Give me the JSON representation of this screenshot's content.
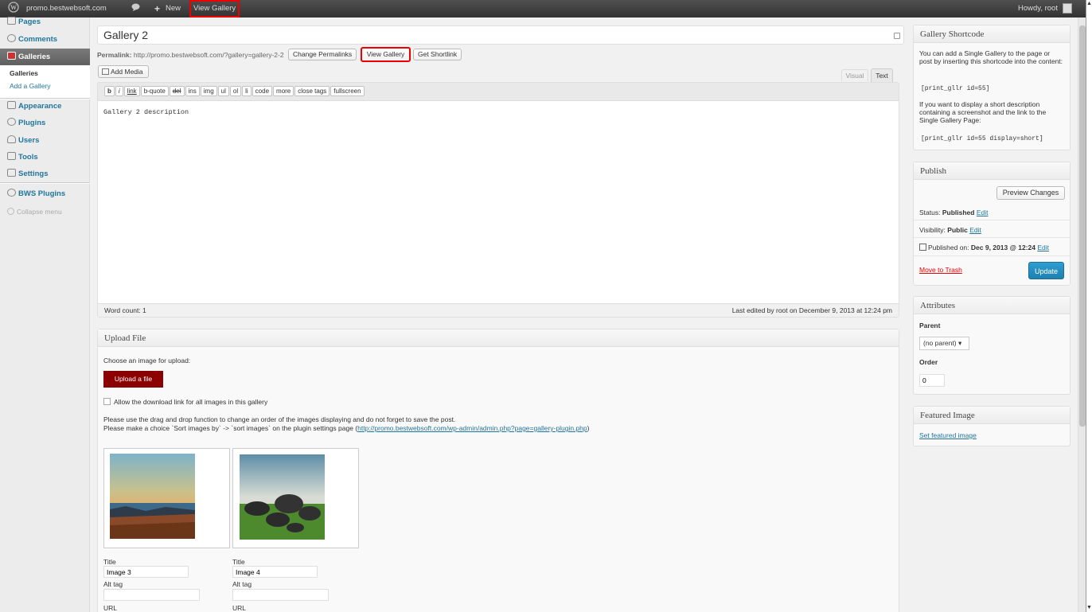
{
  "adminbar": {
    "site": "promo.bestwebsoft.com",
    "new_label": "New",
    "view_gallery": "View Gallery",
    "howdy": "Howdy, root"
  },
  "sidebar": {
    "pages": "Pages",
    "comments": "Comments",
    "galleries": "Galleries",
    "sub_galleries": "Galleries",
    "sub_add": "Add a Gallery",
    "appearance": "Appearance",
    "plugins": "Plugins",
    "users": "Users",
    "tools": "Tools",
    "settings": "Settings",
    "bws": "BWS Plugins",
    "collapse": "Collapse menu"
  },
  "editor": {
    "title": "Gallery 2",
    "permalink_label": "Permalink:",
    "permalink_url": "http://promo.bestwebsoft.com/?gallery=gallery-2-2",
    "change_permalinks": "Change Permalinks",
    "view_gallery": "View Gallery",
    "get_shortlink": "Get Shortlink",
    "add_media": "Add Media",
    "tab_visual": "Visual",
    "tab_text": "Text",
    "quicktags": [
      "b",
      "i",
      "link",
      "b-quote",
      "del",
      "ins",
      "img",
      "ul",
      "ol",
      "li",
      "code",
      "more",
      "close tags",
      "fullscreen"
    ],
    "content": "Gallery 2 description",
    "word_count": "Word count: 1",
    "last_edited": "Last edited by root on December 9, 2013 at 12:24 pm"
  },
  "upload": {
    "title": "Upload File",
    "choose": "Choose an image for upload:",
    "button": "Upload a file",
    "allow_download": "Allow the download link for all images in this gallery",
    "note1": "Please use the drag and drop function to change an order of the images displaying and do not forget to save the post.",
    "note2_prefix": "Please make a choice `Sort images by` -> `sort images` on the plugin settings page (",
    "note2_link": "http://promo.bestwebsoft.com/wp-admin/admin.php?page=gallery-plugin.php",
    "note2_suffix": ")",
    "images": [
      {
        "title_label": "Title",
        "title": "Image 3",
        "alt_label": "Alt tag",
        "alt": "",
        "url_label": "URL"
      },
      {
        "title_label": "Title",
        "title": "Image 4",
        "alt_label": "Alt tag",
        "alt": "",
        "url_label": "URL"
      }
    ]
  },
  "shortcode": {
    "title": "Gallery Shortcode",
    "text1": "You can add a Single Gallery to the page or post by inserting this shortcode into the content:",
    "code1": "[print_gllr id=55]",
    "text2": "If you want to display a short description containing a screenshot and the link to the Single Gallery Page:",
    "code2": "[print_gllr id=55 display=short]"
  },
  "publish": {
    "title": "Publish",
    "preview": "Preview Changes",
    "status_label": "Status:",
    "status_value": "Published",
    "visibility_label": "Visibility:",
    "visibility_value": "Public",
    "published_label": "Published on:",
    "published_value": "Dec 9, 2013 @ 12:24",
    "edit": "Edit",
    "trash": "Move to Trash",
    "update": "Update"
  },
  "attributes": {
    "title": "Attributes",
    "parent_label": "Parent",
    "parent_value": "(no parent)",
    "order_label": "Order",
    "order_value": "0"
  },
  "featured": {
    "title": "Featured Image",
    "link": "Set featured image"
  },
  "colors": {
    "highlight": "#e00000",
    "admin_bar": "#464646",
    "link": "#21759b",
    "primary_button": "#2e8fc0",
    "upload_button": "#8b0000"
  }
}
